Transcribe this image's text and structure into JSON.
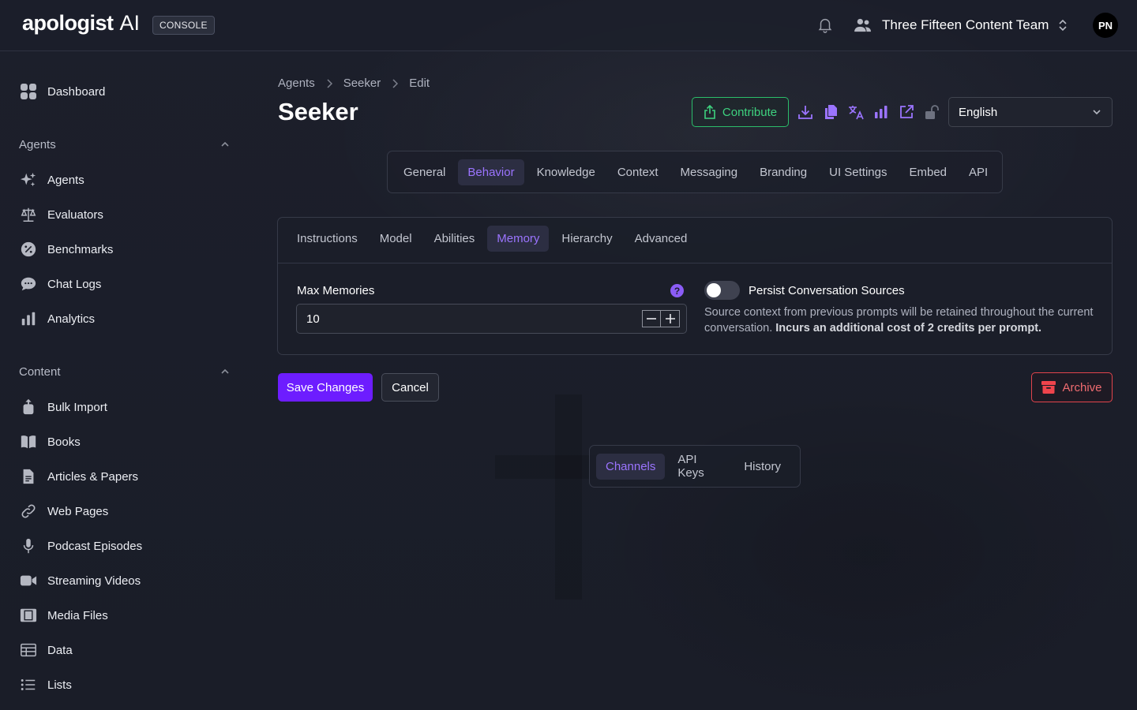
{
  "app": {
    "logo_text": "apologist",
    "logo_suffix": "AI",
    "console_badge": "CONSOLE"
  },
  "header": {
    "team_name": "Three Fifteen Content Team",
    "avatar_initials": "PN"
  },
  "sidebar": {
    "dashboard": "Dashboard",
    "agents_section": "Agents",
    "agents_items": [
      "Agents",
      "Evaluators",
      "Benchmarks",
      "Chat Logs",
      "Analytics"
    ],
    "content_section": "Content",
    "content_items": [
      "Bulk Import",
      "Books",
      "Articles & Papers",
      "Web Pages",
      "Podcast Episodes",
      "Streaming Videos",
      "Media Files",
      "Data",
      "Lists"
    ]
  },
  "breadcrumb": [
    "Agents",
    "Seeker",
    "Edit"
  ],
  "page_title": "Seeker",
  "toolbar": {
    "contribute_label": "Contribute",
    "language": "English"
  },
  "main_tabs": [
    "General",
    "Behavior",
    "Knowledge",
    "Context",
    "Messaging",
    "Branding",
    "UI Settings",
    "Embed",
    "API"
  ],
  "active_main_tab": "Behavior",
  "sub_tabs": [
    "Instructions",
    "Model",
    "Abilities",
    "Memory",
    "Hierarchy",
    "Advanced"
  ],
  "active_sub_tab": "Memory",
  "memory": {
    "max_memories_label": "Max Memories",
    "max_memories_value": "10",
    "persist_label": "Persist Conversation Sources",
    "persist_enabled": false,
    "persist_desc": "Source context from previous prompts will be retained throughout the current conversation.",
    "persist_desc_bold": "Incurs an additional cost of 2 credits per prompt."
  },
  "actions": {
    "save": "Save Changes",
    "cancel": "Cancel",
    "archive": "Archive"
  },
  "bottom_tabs": [
    "Channels",
    "API Keys",
    "History"
  ],
  "active_bottom_tab": "Channels",
  "colors": {
    "accent": "#6d1dff",
    "active_tab_text": "#9b74ff",
    "contribute": "#3ed27f",
    "archive": "#f06c70"
  }
}
